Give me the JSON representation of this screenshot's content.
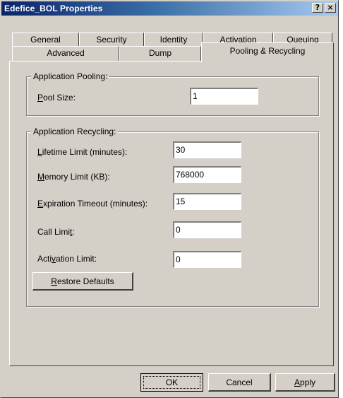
{
  "window": {
    "title": "Edefice_BOL Properties",
    "help_glyph": "?",
    "close_glyph": "×"
  },
  "tabs": {
    "row1": [
      "General",
      "Security",
      "Identity",
      "Activation",
      "Queuing"
    ],
    "row2": [
      "Advanced",
      "Dump",
      "Pooling & Recycling"
    ],
    "selected": "Pooling & Recycling"
  },
  "pooling": {
    "group_title": "Application Pooling:",
    "pool_size_label": "Pool Size:",
    "pool_size_value": "1"
  },
  "recycling": {
    "group_title": "Application Recycling:",
    "lifetime_label": "Lifetime Limit (minutes):",
    "lifetime_value": "30",
    "memory_label": "Memory Limit (KB):",
    "memory_value": "768000",
    "expiration_label": "Expiration Timeout (minutes):",
    "expiration_value": "15",
    "call_label": "Call Limit:",
    "call_value": "0",
    "activation_label": "Activation Limit:",
    "activation_value": "0",
    "restore_button": "Restore Defaults"
  },
  "footer": {
    "ok": "OK",
    "cancel": "Cancel",
    "apply": "Apply"
  },
  "colors": {
    "dialog_face": "#d4d0c8",
    "title_active": "#0a246a"
  }
}
